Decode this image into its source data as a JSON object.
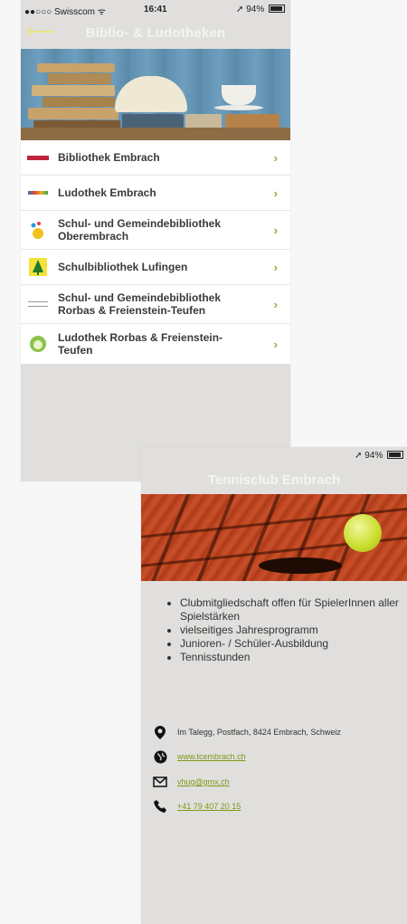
{
  "phone1": {
    "status": {
      "carrier": "●●○○○ Swisscom",
      "wifi": "ᯤ",
      "time": "16:41",
      "location": "➚",
      "battery": "94%"
    },
    "nav": {
      "back": "⟵",
      "title": "Biblio- & Ludotheken"
    },
    "list": [
      {
        "label": "Bibliothek Embrach",
        "logo": "red-bar-logo"
      },
      {
        "label": "Ludothek Embrach",
        "logo": "ludo-text-logo"
      },
      {
        "label": "Schul- und Gemeindebibliothek Oberembrach",
        "logo": "dots-logo"
      },
      {
        "label": "Schulbibliothek Lufingen",
        "logo": "tree-logo"
      },
      {
        "label": "Schul- und Gemeindebibliothek Rorbas & Freienstein-Teufen",
        "logo": "script-logo"
      },
      {
        "label": "Ludothek Rorbas & Freienstein-Teufen",
        "logo": "green-apple-logo"
      }
    ],
    "chevron": "›"
  },
  "phone2": {
    "status": {
      "location": "➚",
      "battery": "94%"
    },
    "title": "Tennisclub Embrach",
    "bullets": [
      "Clubmitgliedschaft offen für SpielerInnen aller Spielstärken",
      "vielseitiges Jahresprogramm",
      "Junioren- / Schüler-Ausbildung",
      "Tennisstunden"
    ],
    "contact": {
      "address": "Im Talegg, Postfach, 8424 Embrach, Schweiz",
      "website": "www.tcembrach.ch",
      "email": "vhug@gmx.ch",
      "phone": "+41 79 407 20 15"
    }
  },
  "colors": {
    "accent": "#8bb020",
    "nav_yellow": "#e8e67e",
    "panel_bg": "#e0dfdd"
  }
}
